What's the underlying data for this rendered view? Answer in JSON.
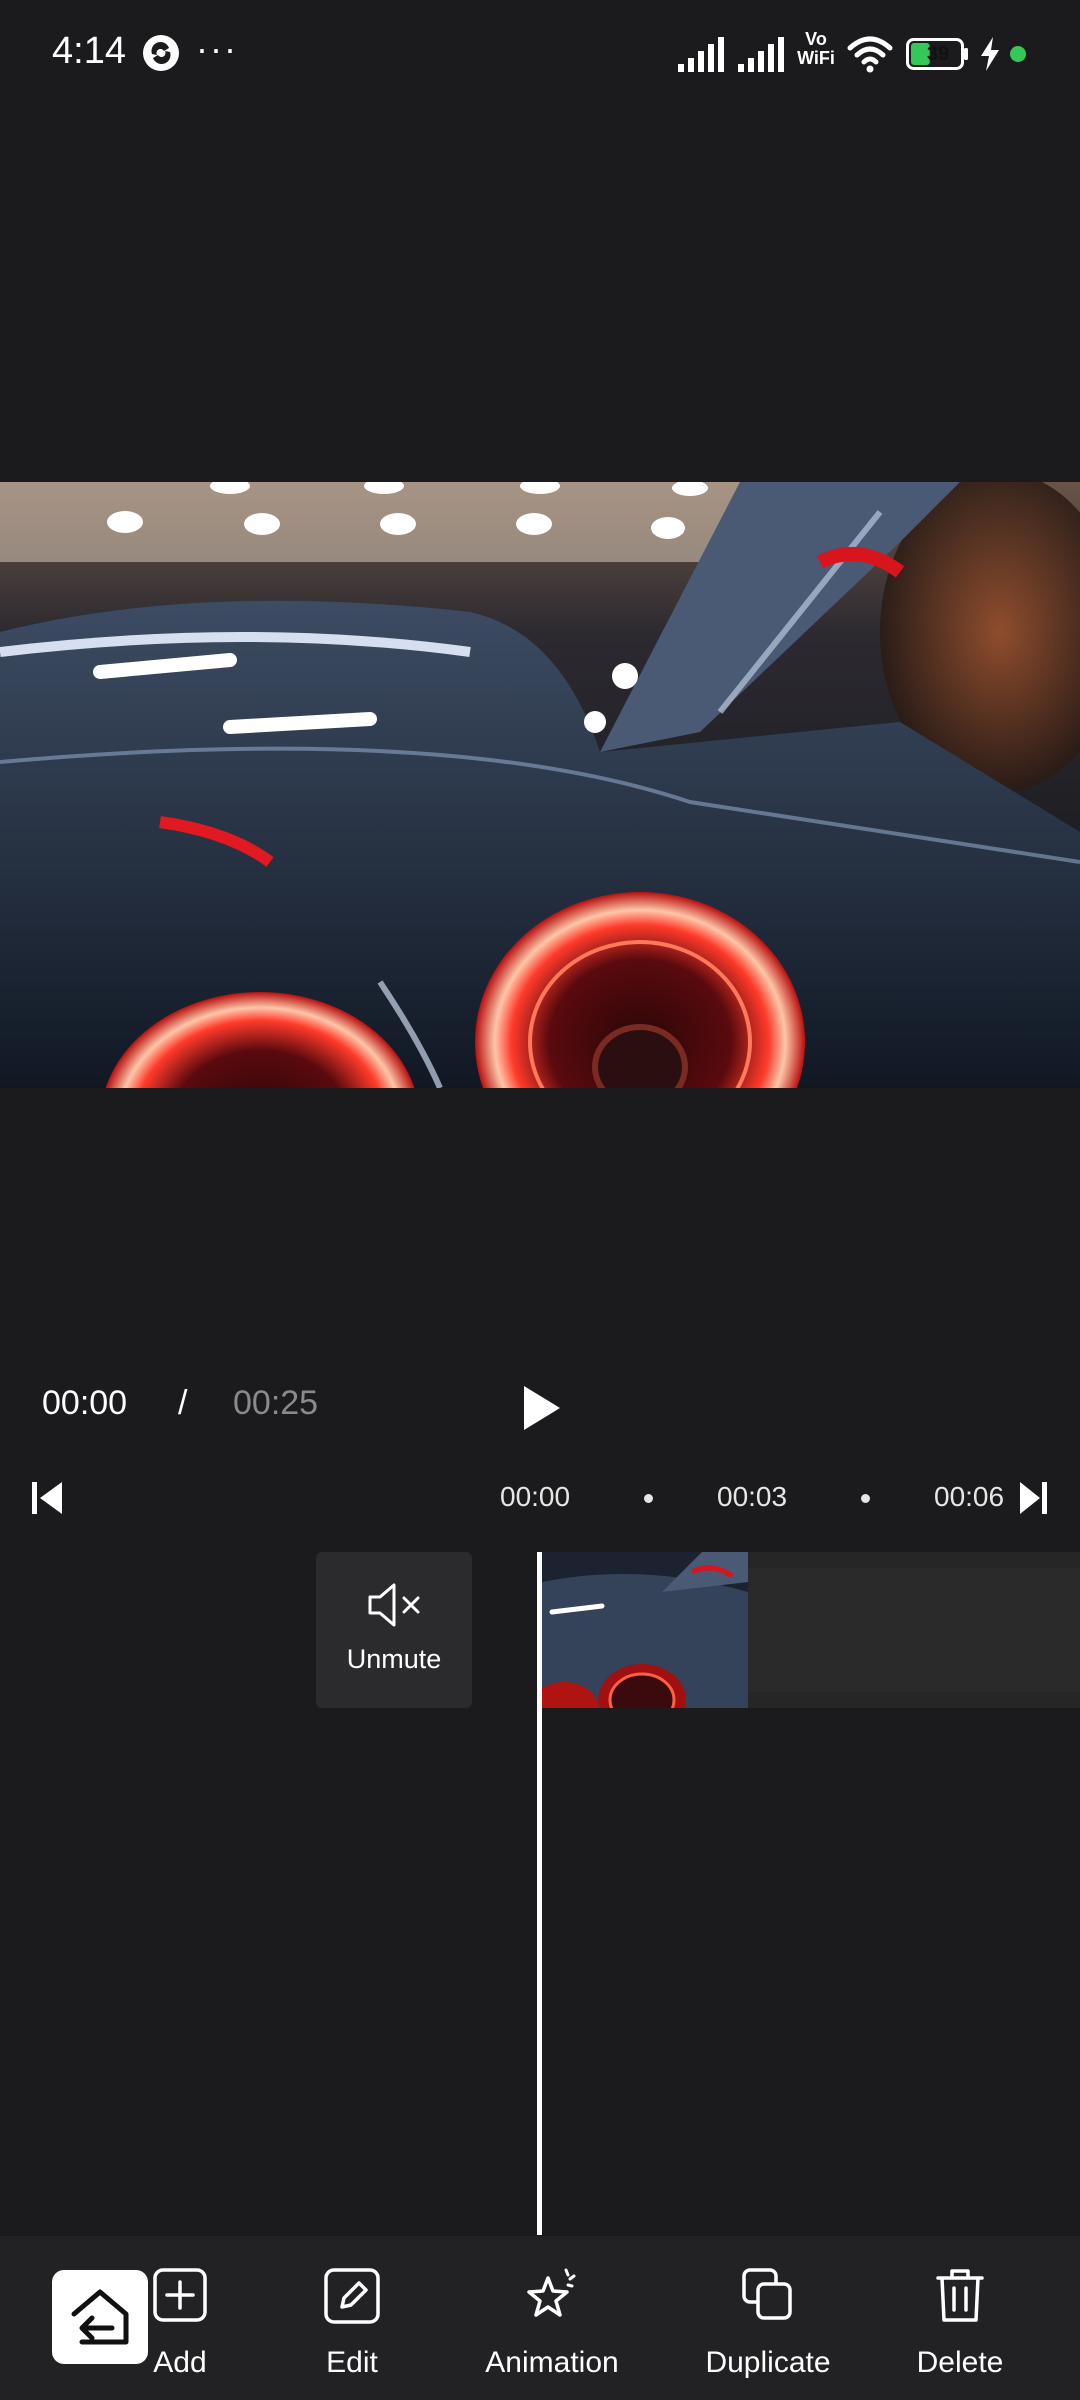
{
  "status_bar": {
    "time": "4:14",
    "more": "···",
    "vowifi_top": "Vo",
    "vowifi_bottom": "WiFi",
    "battery_level": "39",
    "battery_color": "#34c759"
  },
  "playback": {
    "current_time": "00:00",
    "separator": "/",
    "total_time": "00:25"
  },
  "ruler": {
    "ticks": [
      "00:00",
      "00:03",
      "00:06"
    ]
  },
  "timeline": {
    "unmute_label": "Unmute"
  },
  "toolbar": {
    "add_label": "Add",
    "edit_label": "Edit",
    "animation_label": "Animation",
    "duplicate_label": "Duplicate",
    "delete_label": "Delete"
  },
  "icons": {
    "back": "back-arrow-icon",
    "play": "play-icon",
    "jump_start": "skip-to-start-icon",
    "jump_end": "skip-to-end-icon",
    "mute": "speaker-muted-icon"
  }
}
